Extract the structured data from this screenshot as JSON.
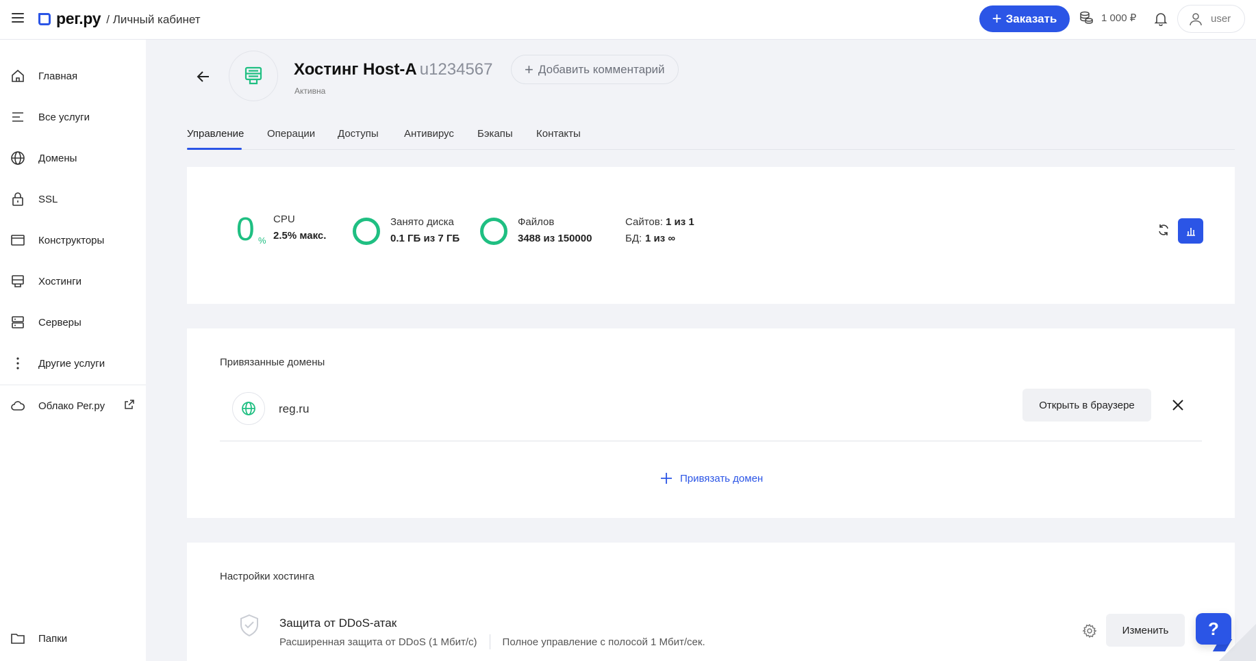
{
  "header": {
    "logo_text": "рег.ру",
    "logo_sub": "/ Личный кабинет",
    "order_label": "Заказать",
    "balance": "1 000 ₽",
    "username": "user"
  },
  "sidebar": {
    "items": [
      {
        "label": "Главная",
        "icon": "home-icon"
      },
      {
        "label": "Все услуги",
        "icon": "list-icon"
      },
      {
        "label": "Домены",
        "icon": "globe-icon"
      },
      {
        "label": "SSL",
        "icon": "lock-icon"
      },
      {
        "label": "Конструкторы",
        "icon": "browser-window-icon"
      },
      {
        "label": "Хостинги",
        "icon": "hosting-icon"
      },
      {
        "label": "Серверы",
        "icon": "server-icon"
      },
      {
        "label": "Другие услуги",
        "icon": "more-vertical-icon"
      }
    ],
    "cloud_label": "Облако Рег.ру",
    "folders_label": "Папки"
  },
  "service": {
    "title": "Хостинг Host-A",
    "account": "u1234567",
    "status": "Активна",
    "comment_label": "Добавить комментарий"
  },
  "tabs": [
    "Управление",
    "Операции",
    "Доступы",
    "Антивирус",
    "Бэкапы",
    "Контакты"
  ],
  "stats": {
    "cpu_value": "0",
    "cpu_unit": "%",
    "cpu_label": "CPU",
    "cpu_max": "2.5% макс.",
    "disk_label": "Занято диска",
    "disk_value": "0.1 ГБ из 7 ГБ",
    "files_label": "Файлов",
    "files_value": "3488 из 150000",
    "sites_label": "Сайтов:",
    "sites_value": "1 из 1",
    "db_label": "БД:",
    "db_value": "1 из ∞",
    "disk_used_fraction": 0.014,
    "files_used_fraction": 0.023
  },
  "domains": {
    "title": "Привязанные домены",
    "items": [
      {
        "name": "reg.ru",
        "open_label": "Открыть в браузере"
      }
    ],
    "bind_label": "Привязать домен"
  },
  "settings": {
    "title": "Настройки хостинга",
    "ddos_title": "Защита от DDoS-атак",
    "ddos_desc": "Расширенная защита от DDoS (1 Мбит/с)",
    "ddos_detail": "Полное управление с полосой 1 Мбит/сек.",
    "change_label": "Изменить"
  },
  "help_label": "?",
  "colors": {
    "accent": "#2b55e6",
    "success": "#1fbf82"
  }
}
